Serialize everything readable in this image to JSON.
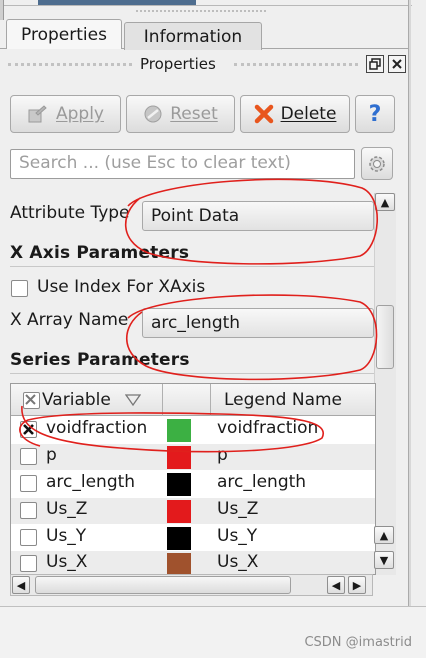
{
  "tabs": [
    {
      "label": "Properties",
      "active": true
    },
    {
      "label": "Information",
      "active": false
    }
  ],
  "dock": {
    "title": "Properties"
  },
  "toolbar": {
    "apply_label": "Apply",
    "reset_label": "Reset",
    "delete_label": "Delete",
    "help_label": "?"
  },
  "search": {
    "placeholder": "Search ... (use Esc to clear text)"
  },
  "attribute": {
    "label": "Attribute Type",
    "value": "Point Data"
  },
  "x_axis": {
    "header": "X Axis Parameters",
    "use_index_label": "Use Index For XAxis",
    "use_index_checked": false,
    "array_label": "X Array Name",
    "array_value": "arc_length"
  },
  "series": {
    "header": "Series Parameters",
    "columns": [
      "Variable",
      "Legend Name"
    ],
    "rows": [
      {
        "variable": "voidfraction",
        "legend": "voidfraction",
        "checked": true,
        "color": "#3cb043"
      },
      {
        "variable": "p",
        "legend": "p",
        "checked": false,
        "color": "#e31a1c"
      },
      {
        "variable": "arc_length",
        "legend": "arc_length",
        "checked": false,
        "color": "#000000"
      },
      {
        "variable": "Us_Z",
        "legend": "Us_Z",
        "checked": false,
        "color": "#e31a1c"
      },
      {
        "variable": "Us_Y",
        "legend": "Us_Y",
        "checked": false,
        "color": "#000000"
      },
      {
        "variable": "Us_X",
        "legend": "Us_X",
        "checked": false,
        "color": "#a0522d"
      }
    ]
  },
  "watermark": "CSDN @imastrid",
  "colors": {
    "annotation": "#e0201c",
    "help_blue": "#2f6fd0",
    "delete_orange": "#e8561e"
  }
}
